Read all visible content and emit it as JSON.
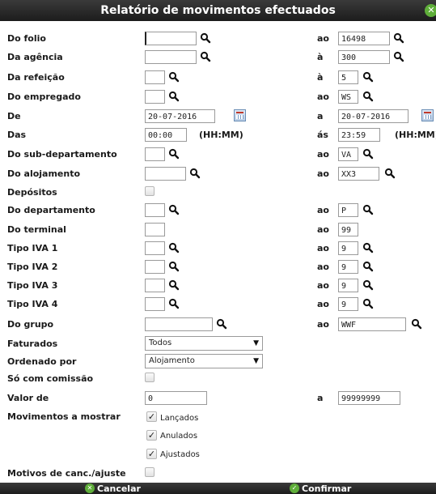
{
  "title": "Relatório de movimentos efectuados",
  "title_close": "✕",
  "rows": {
    "folio": {
      "label": "Do folio",
      "from": "",
      "to_label": "ao",
      "to": "16498"
    },
    "agencia": {
      "label": "Da agência",
      "from": "",
      "to_label": "à",
      "to": "300"
    },
    "refeicao": {
      "label": "Da refeição",
      "from": "",
      "to_label": "à",
      "to": "5"
    },
    "empregado": {
      "label": "Do empregado",
      "from": "",
      "to_label": "ao",
      "to": "WS"
    },
    "de": {
      "label": "De",
      "from": "20-07-2016",
      "to_label": "a",
      "to": "20-07-2016"
    },
    "das": {
      "label": "Das",
      "from": "00:00",
      "hint": "(HH:MM)",
      "to_label": "ás",
      "to": "23:59",
      "hint2": "(HH:MM)"
    },
    "subdep": {
      "label": "Do sub-departamento",
      "from": "",
      "to_label": "ao",
      "to": "VA"
    },
    "alojamento": {
      "label": "Do alojamento",
      "from": "",
      "to_label": "ao",
      "to": "XX3"
    },
    "depositos": {
      "label": "Depósitos"
    },
    "departamento": {
      "label": "Do departamento",
      "from": "",
      "to_label": "ao",
      "to": "P"
    },
    "terminal": {
      "label": "Do terminal",
      "from": "",
      "to_label": "ao",
      "to": "99"
    },
    "iva1": {
      "label": "Tipo IVA 1",
      "from": "",
      "to_label": "ao",
      "to": "9"
    },
    "iva2": {
      "label": "Tipo IVA 2",
      "from": "",
      "to_label": "ao",
      "to": "9"
    },
    "iva3": {
      "label": "Tipo IVA 3",
      "from": "",
      "to_label": "ao",
      "to": "9"
    },
    "iva4": {
      "label": "Tipo IVA 4",
      "from": "",
      "to_label": "ao",
      "to": "9"
    },
    "grupo": {
      "label": "Do grupo",
      "from": "",
      "to_label": "ao",
      "to": "WWF"
    },
    "faturados": {
      "label": "Faturados",
      "value": "Todos"
    },
    "ordenado": {
      "label": "Ordenado por",
      "value": "Alojamento"
    },
    "comissao": {
      "label": "Só com comissão"
    },
    "valor": {
      "label": "Valor de",
      "from": "0",
      "to_label": "a",
      "to": "99999999"
    },
    "movimentos": {
      "label": "Movimentos a mostrar",
      "options": [
        "Lançados",
        "Anulados",
        "Ajustados"
      ]
    },
    "motivos": {
      "label": "Motivos de canc./ajuste"
    }
  },
  "footer": {
    "cancel": "Cancelar",
    "confirm": "Confirmar"
  },
  "colors": {
    "bar": "#2a2a2a",
    "accent_green": "#5fae3a"
  }
}
